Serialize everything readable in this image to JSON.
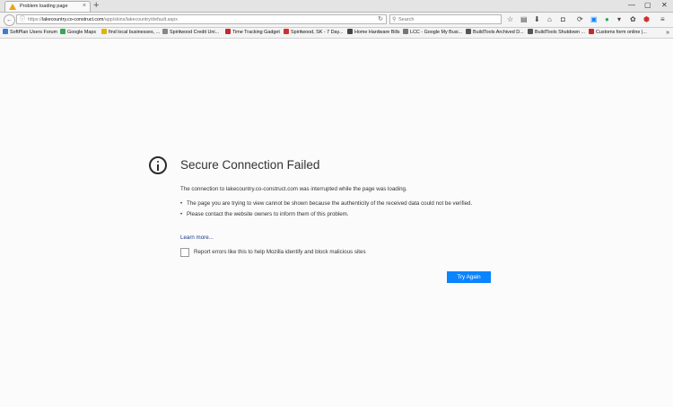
{
  "tab": {
    "title": "Problem loading page",
    "close": "×",
    "new_tab": "+"
  },
  "window_controls": {
    "minimize": "—",
    "restore": "▢",
    "close": "✕"
  },
  "nav": {
    "back": "←",
    "info": "ⓘ",
    "url_prefix": "https://",
    "url_domain": "lakecountry.co-construct.com",
    "url_path": "/app/skins/lakecountry/default.aspx",
    "reload": "↻",
    "search_placeholder": "Search",
    "search_glyph": "⚲"
  },
  "toolbar_icons": [
    "star-icon",
    "reading-list-icon",
    "download-icon",
    "home-icon",
    "pocket-icon",
    "sync-icon",
    "screenshot-icon",
    "addon-green-icon",
    "addon-menu-icon",
    "bug-icon",
    "adblock-icon",
    "menu-icon"
  ],
  "bookmarks": [
    {
      "label": "SoftPlan Users Forum",
      "color": "#3c7bd6"
    },
    {
      "label": "Google Maps",
      "color": "#34a853"
    },
    {
      "label": "find local businesses, ...",
      "color": "#e0b400"
    },
    {
      "label": "Spiritwood Credit Uni...",
      "color": "#888888"
    },
    {
      "label": "Time Tracking Gadget",
      "color": "#c62828"
    },
    {
      "label": "Spiritwood, SK - 7 Day...",
      "color": "#d32f2f"
    },
    {
      "label": "Home Hardware Bills",
      "color": "#444444"
    },
    {
      "label": "LCC - Google My Busi...",
      "color": "#777777"
    },
    {
      "label": "BuildTools Archived D...",
      "color": "#555555"
    },
    {
      "label": "BuildTools Shutdown ...",
      "color": "#555555"
    },
    {
      "label": "Customs form online |...",
      "color": "#c62828"
    }
  ],
  "bookmarks_more": "»",
  "error": {
    "title": "Secure Connection Failed",
    "description": "The connection to lakecountry.co-construct.com was interrupted while the page was loading.",
    "bullets": [
      "The page you are trying to view cannot be shown because the authenticity of the received data could not be verified.",
      "Please contact the website owners to inform them of this problem."
    ],
    "learn_more": "Learn more...",
    "report_label": "Report errors like this to help Mozilla identify and block malicious sites",
    "try_again": "Try Again"
  },
  "colors": {
    "accent": "#0a84ff",
    "link": "#1a3a8c"
  }
}
